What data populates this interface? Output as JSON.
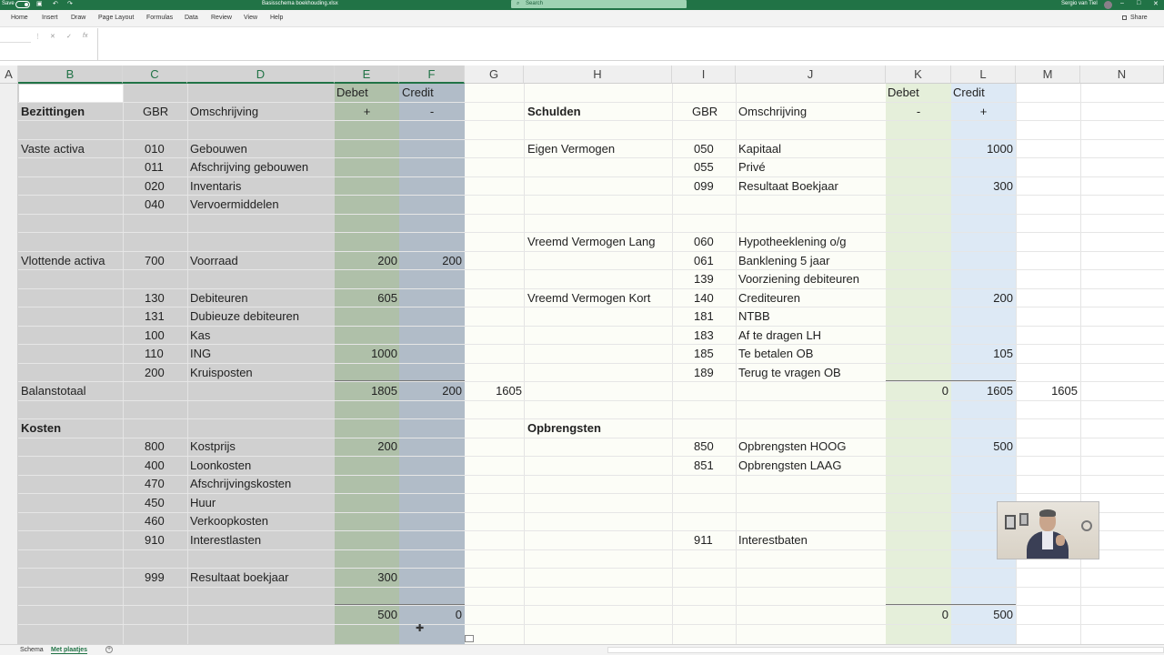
{
  "titlebar": {
    "autosave_label": "Save",
    "filename": "Basisschema boekhouding.xlsx",
    "search_placeholder": "Search",
    "user_name": "Sergio van Tiel",
    "window_buttons": [
      "–",
      "□",
      "✕"
    ]
  },
  "ribbon": {
    "tabs": [
      "Home",
      "Insert",
      "Draw",
      "Page Layout",
      "Formulas",
      "Data",
      "Review",
      "View",
      "Help"
    ],
    "share_label": "Share"
  },
  "formula_bar": {
    "name_box": "",
    "icons": [
      "cancel-icon",
      "enter-icon",
      "function-icon"
    ],
    "fx_label": "fx",
    "content": ""
  },
  "columns": [
    "A",
    "B",
    "C",
    "D",
    "E",
    "F",
    "G",
    "H",
    "I",
    "J",
    "K",
    "L",
    "M",
    "N"
  ],
  "colors": {
    "accent": "#217346",
    "left_block": "#d0d0d0",
    "debet_left": "#afc0a9",
    "credit_left": "#b1bcc8",
    "debet_right": "#e5efda",
    "credit_right": "#dde9f5",
    "right_bg": "#fcfdf7"
  },
  "sheet": {
    "left": {
      "header_debet": "Debet",
      "header_credit": "Credit",
      "title": "Bezittingen",
      "gbr": "GBR",
      "omschrijving": "Omschrijving",
      "plus": "+",
      "minus": "-",
      "vaste_activa": "Vaste activa",
      "rows_vaste": [
        {
          "code": "010",
          "name": "Gebouwen",
          "debet": "",
          "credit": ""
        },
        {
          "code": "011",
          "name": "Afschrijving gebouwen",
          "debet": "",
          "credit": ""
        },
        {
          "code": "020",
          "name": "Inventaris",
          "debet": "",
          "credit": ""
        },
        {
          "code": "040",
          "name": "Vervoermiddelen",
          "debet": "",
          "credit": ""
        }
      ],
      "vlottende_activa": "Vlottende activa",
      "rows_vlottend": [
        {
          "code": "700",
          "name": "Voorraad",
          "debet": "200",
          "credit": "200"
        },
        {
          "code": "130",
          "name": "Debiteuren",
          "debet": "605",
          "credit": ""
        },
        {
          "code": "131",
          "name": "Dubieuze debiteuren",
          "debet": "",
          "credit": ""
        },
        {
          "code": "100",
          "name": "Kas",
          "debet": "",
          "credit": ""
        },
        {
          "code": "110",
          "name": "ING",
          "debet": "1000",
          "credit": ""
        },
        {
          "code": "200",
          "name": "Kruisposten",
          "debet": "",
          "credit": ""
        }
      ],
      "balanstotaal": "Balanstotaal",
      "balans_debet": "1805",
      "balans_credit": "200",
      "balans_g": "1605",
      "kosten": "Kosten",
      "rows_kosten": [
        {
          "code": "800",
          "name": "Kostprijs",
          "debet": "200"
        },
        {
          "code": "400",
          "name": "Loonkosten",
          "debet": ""
        },
        {
          "code": "470",
          "name": "Afschrijvingskosten",
          "debet": ""
        },
        {
          "code": "450",
          "name": "Huur",
          "debet": ""
        },
        {
          "code": "460",
          "name": "Verkoopkosten",
          "debet": ""
        },
        {
          "code": "910",
          "name": "Interestlasten",
          "debet": ""
        }
      ],
      "resultaat": {
        "code": "999",
        "name": "Resultaat boekjaar",
        "debet": "300"
      },
      "kosten_total_debet": "500",
      "kosten_total_credit": "0"
    },
    "right": {
      "header_debet": "Debet",
      "header_credit": "Credit",
      "title": "Schulden",
      "gbr": "GBR",
      "omschrijving": "Omschrijving",
      "minus": "-",
      "plus": "+",
      "eigen_vermogen": "Eigen Vermogen",
      "rows_ev": [
        {
          "code": "050",
          "name": "Kapitaal",
          "credit": "1000"
        },
        {
          "code": "055",
          "name": "Privé",
          "credit": ""
        },
        {
          "code": "099",
          "name": "Resultaat Boekjaar",
          "credit": "300"
        }
      ],
      "vv_lang": "Vreemd Vermogen Lang",
      "rows_vvl": [
        {
          "code": "060",
          "name": "Hypotheeklening o/g",
          "credit": ""
        },
        {
          "code": "061",
          "name": "Banklening 5 jaar",
          "credit": ""
        },
        {
          "code": "139",
          "name": "Voorziening debiteuren",
          "credit": ""
        }
      ],
      "vv_kort": "Vreemd Vermogen Kort",
      "rows_vvk": [
        {
          "code": "140",
          "name": "Crediteuren",
          "credit": "200"
        },
        {
          "code": "181",
          "name": "NTBB",
          "credit": ""
        },
        {
          "code": "183",
          "name": "Af te dragen LH",
          "credit": ""
        },
        {
          "code": "185",
          "name": "Te betalen OB",
          "credit": "105"
        },
        {
          "code": "189",
          "name": "Terug te vragen OB",
          "credit": ""
        }
      ],
      "balans_debet": "0",
      "balans_credit": "1605",
      "balans_m": "1605",
      "opbrengsten": "Opbrengsten",
      "rows_opbr": [
        {
          "code": "850",
          "name": "Opbrengsten HOOG",
          "credit": "500"
        },
        {
          "code": "851",
          "name": "Opbrengsten LAAG",
          "credit": ""
        }
      ],
      "interest": {
        "code": "911",
        "name": "Interestbaten"
      },
      "opbr_total_debet": "0",
      "opbr_total_credit": "500"
    }
  },
  "sheet_tabs": [
    {
      "label": "Schema",
      "active": false
    },
    {
      "label": "Met plaatjes",
      "active": true
    }
  ],
  "add_sheet_label": "+"
}
